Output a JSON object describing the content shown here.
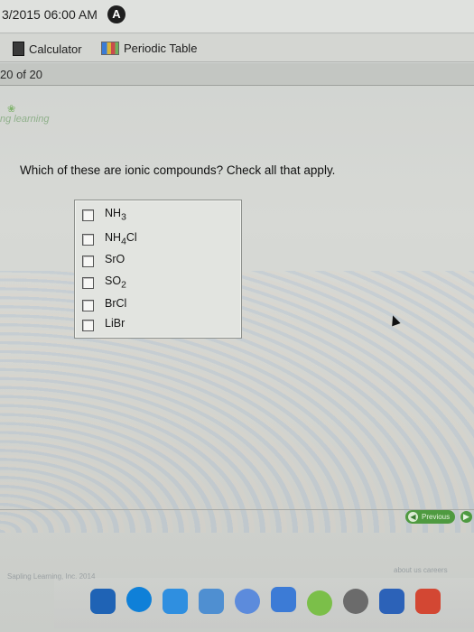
{
  "window": {
    "datetime": "3/2015 06:00 AM",
    "accessibility_icon_glyph": "A"
  },
  "toolbar": {
    "calculator_label": "Calculator",
    "periodic_table_label": "Periodic Table"
  },
  "question_bar": {
    "counter": "20 of 20"
  },
  "branding": {
    "text": "ng learning"
  },
  "question": {
    "prompt": "Which of these are ionic compounds? Check all that apply."
  },
  "answers": [
    {
      "label_main": "NH",
      "label_sub": "3",
      "label_tail": "",
      "checked": false
    },
    {
      "label_main": "NH",
      "label_sub": "4",
      "label_tail": "Cl",
      "checked": false
    },
    {
      "label_main": "SrO",
      "label_sub": "",
      "label_tail": "",
      "checked": false
    },
    {
      "label_main": "SO",
      "label_sub": "2",
      "label_tail": "",
      "checked": false
    },
    {
      "label_main": "BrCl",
      "label_sub": "",
      "label_tail": "",
      "checked": false
    },
    {
      "label_main": "LiBr",
      "label_sub": "",
      "label_tail": "",
      "checked": false
    }
  ],
  "navigation": {
    "previous_label": "Previous"
  },
  "footer": {
    "left": "Sapling Learning, Inc. 2014",
    "right": "about us  careers"
  },
  "colors": {
    "accent_green": "#4f9a40",
    "bg": "#d9dcd8"
  }
}
